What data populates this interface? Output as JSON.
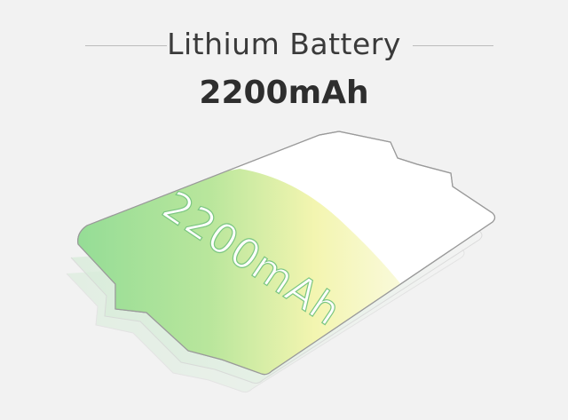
{
  "header": {
    "title": "Lithium Battery",
    "capacity": "2200mAh"
  },
  "battery": {
    "label": "2200mAh"
  },
  "colors": {
    "background": "#f2f2f2",
    "green": "#8fdb96",
    "yellow": "#f3f5b0",
    "outline": "#9a9a9a"
  }
}
